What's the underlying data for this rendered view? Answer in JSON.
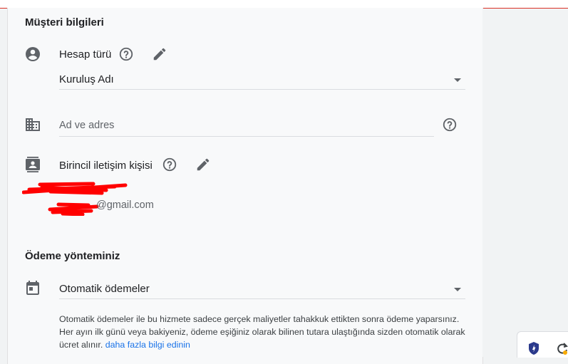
{
  "customer": {
    "section_title": "Müşteri bilgileri",
    "account_type": {
      "label": "Hesap türü",
      "value": "Kuruluş Adı"
    },
    "address": {
      "placeholder": "Ad ve adres"
    },
    "contact": {
      "label": "Birincil iletişim kişisi",
      "email_suffix": "@gmail.com"
    }
  },
  "payment": {
    "section_title": "Ödeme yönteminiz",
    "method": "Otomatik ödemeler",
    "info_text": "Otomatik ödemeler ile bu hizmete sadece gerçek maliyetler tahakkuk ettikten sonra ödeme yaparsınız. Her ayın ilk günü veya bakiyeniz, ödeme eşiğiniz olarak bilinen tutara ulaştığında sizden otomatik olarak ücret alınır.",
    "learn_more": "daha fazla bilgi edinin"
  },
  "colors": {
    "link": "#1a73e8",
    "redaction": "#ff0000",
    "top_border": "#d93025"
  }
}
